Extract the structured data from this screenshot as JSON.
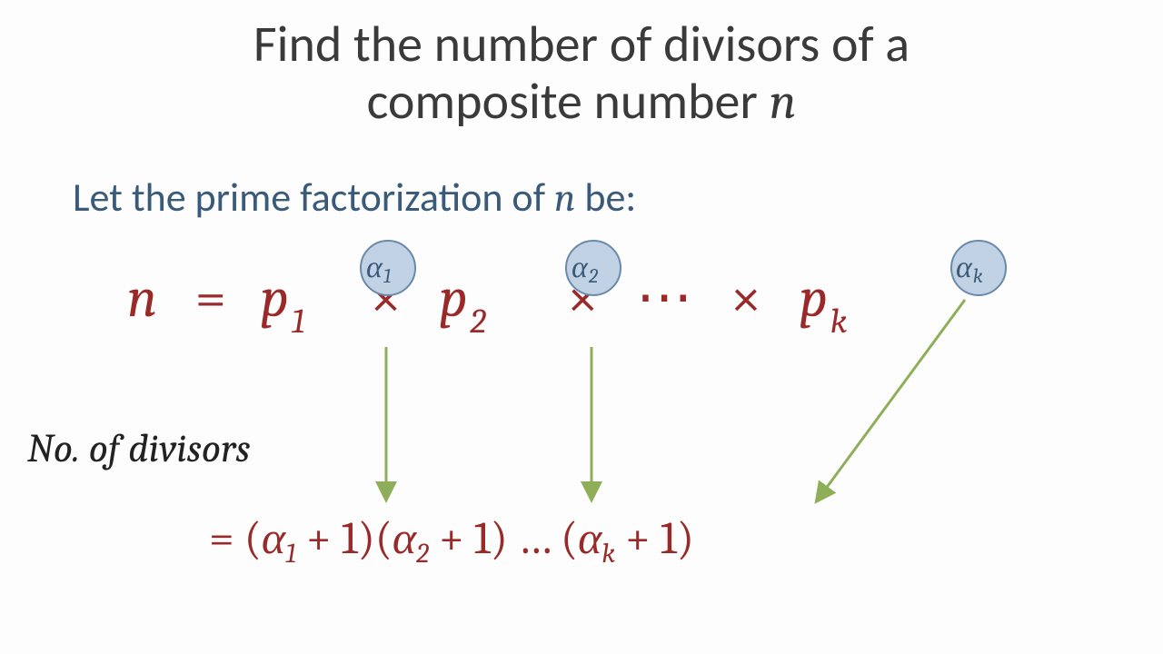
{
  "title_line1": "Find the number of divisors of a",
  "title_line2_pre": "composite number ",
  "title_var": "n",
  "sub_pre": "Let the prime factorization of ",
  "sub_var": "n",
  "sub_post": " be:",
  "eq1": {
    "lhs": "n",
    "eq": " = ",
    "p": "p",
    "sub1": "1",
    "sub2": "2",
    "subk": "k",
    "times": "×",
    "dots": "⋯"
  },
  "alpha": {
    "sym": "α",
    "s1": "1",
    "s2": "2",
    "sk": "k"
  },
  "label_no": "No. of divisors",
  "eq2": {
    "eq": "= ",
    "open": "(",
    "close": ")",
    "alpha": "α",
    "s1": "1",
    "s2": "2",
    "sk": "k",
    "plus1": " + 1",
    "dots": " … "
  }
}
